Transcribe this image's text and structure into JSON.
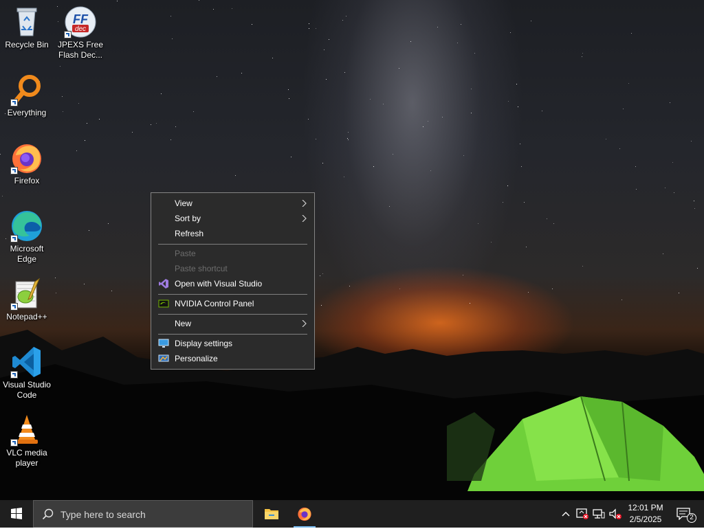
{
  "desktop": {
    "icons": [
      {
        "id": "recycle-bin",
        "label": "Recycle Bin",
        "icon": "recycle-bin-icon"
      },
      {
        "id": "jpexs",
        "label": "JPEXS Free Flash Dec...",
        "icon": "jpexs-ffdec-icon",
        "logo_text": "FF",
        "logo_subtext": "dec"
      },
      {
        "id": "everything",
        "label": "Everything",
        "icon": "everything-search-icon"
      },
      {
        "id": "firefox",
        "label": "Firefox",
        "icon": "firefox-icon"
      },
      {
        "id": "edge",
        "label": "Microsoft Edge",
        "icon": "edge-icon"
      },
      {
        "id": "notepadpp",
        "label": "Notepad++",
        "icon": "notepadpp-icon"
      },
      {
        "id": "vscode",
        "label": "Visual Studio Code",
        "icon": "vscode-icon"
      },
      {
        "id": "vlc",
        "label": "VLC media player",
        "icon": "vlc-icon"
      }
    ]
  },
  "context_menu": {
    "items": [
      {
        "label": "View",
        "submenu": true,
        "enabled": true
      },
      {
        "label": "Sort by",
        "submenu": true,
        "enabled": true
      },
      {
        "label": "Refresh",
        "enabled": true
      },
      {
        "label": "Paste",
        "enabled": false
      },
      {
        "label": "Paste shortcut",
        "enabled": false
      },
      {
        "label": "Open with Visual Studio",
        "enabled": true,
        "icon": "visual-studio-icon"
      },
      {
        "label": "NVIDIA Control Panel",
        "enabled": true,
        "icon": "nvidia-icon"
      },
      {
        "label": "New",
        "submenu": true,
        "enabled": true
      },
      {
        "label": "Display settings",
        "enabled": true,
        "icon": "display-icon"
      },
      {
        "label": "Personalize",
        "enabled": true,
        "icon": "personalize-icon"
      }
    ]
  },
  "taskbar": {
    "search_placeholder": "Type here to search",
    "pinned_apps": [
      {
        "name": "File Explorer",
        "icon": "file-explorer-icon",
        "active": false
      },
      {
        "name": "Firefox",
        "icon": "firefox-icon",
        "active": true
      }
    ],
    "tray_icons": [
      "chevron-up-icon",
      "security-alert-icon",
      "network-icon",
      "volume-muted-icon"
    ],
    "clock": {
      "time": "12:01 PM",
      "date": "2/5/2025"
    },
    "notification_count": "2"
  },
  "colors": {
    "menu_bg": "#2b2b2b",
    "menu_border": "#858585",
    "taskbar_bg": "#1f1f1f",
    "search_bg": "#3c3c3c",
    "accent": "#76b9ed"
  }
}
